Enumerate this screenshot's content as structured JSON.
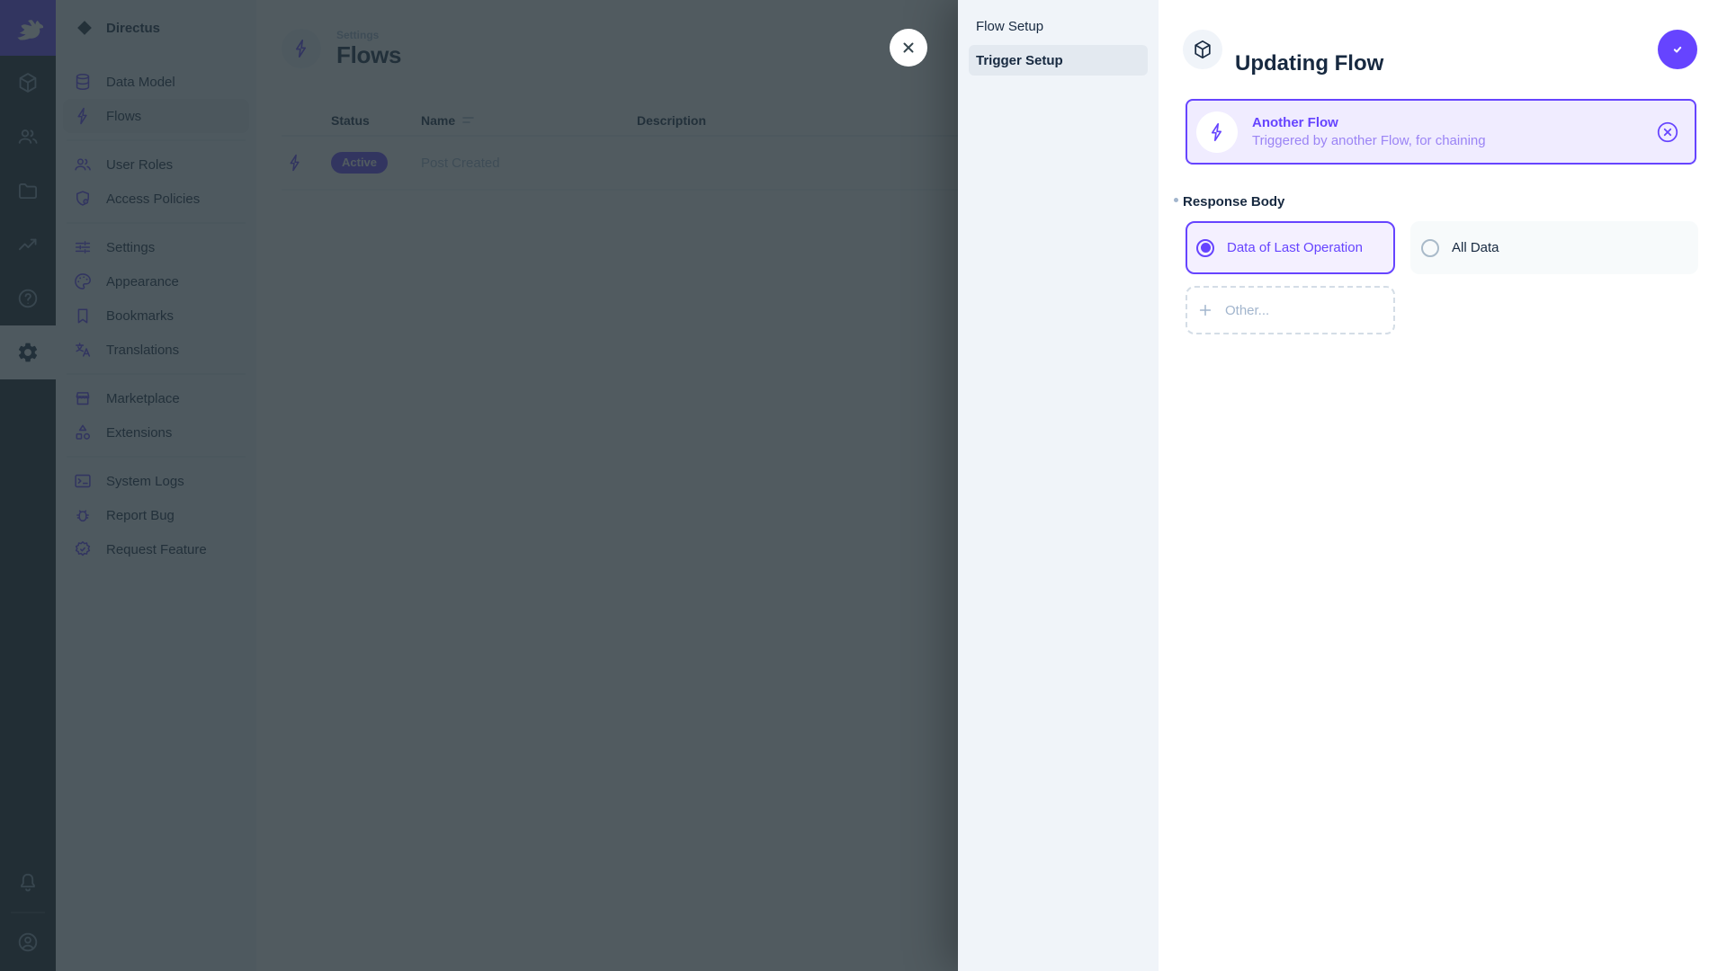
{
  "colors": {
    "accent": "#6644FF",
    "module_bar_bg": "#18212B",
    "module_icon": "#8196AB",
    "panel_bg": "#F0F4F9",
    "panel_active_bg": "#E4EAF1",
    "text_dark": "#172940",
    "text_muted": "#A2B5CD",
    "border_subtle": "#E8EEF4",
    "trigger_card_bg": "#F0ECFF",
    "trigger_sub": "#9B84F5",
    "overlay": "rgba(38,50,56,0.8)"
  },
  "module_bar": {
    "modules": [
      {
        "icon": "cube-icon"
      },
      {
        "icon": "people-icon"
      },
      {
        "icon": "folder-icon"
      },
      {
        "icon": "trending-up-icon"
      },
      {
        "icon": "help-icon"
      },
      {
        "icon": "gear-icon",
        "active": true
      }
    ]
  },
  "sidebar": {
    "project_name": "Directus",
    "items": [
      {
        "label": "Data Model",
        "icon": "database-icon"
      },
      {
        "label": "Flows",
        "icon": "bolt-icon",
        "active": true
      },
      {
        "label": "User Roles",
        "icon": "people-icon"
      },
      {
        "label": "Access Policies",
        "icon": "shield-icon"
      },
      {
        "label": "Settings",
        "icon": "sliders-icon"
      },
      {
        "label": "Appearance",
        "icon": "palette-icon"
      },
      {
        "label": "Bookmarks",
        "icon": "bookmark-icon"
      },
      {
        "label": "Translations",
        "icon": "translate-icon"
      },
      {
        "label": "Marketplace",
        "icon": "storefront-icon"
      },
      {
        "label": "Extensions",
        "icon": "shapes-icon"
      },
      {
        "label": "System Logs",
        "icon": "terminal-icon"
      },
      {
        "label": "Report Bug",
        "icon": "bug-icon"
      },
      {
        "label": "Request Feature",
        "icon": "badge-check-icon"
      }
    ]
  },
  "main": {
    "breadcrumb": "Settings",
    "title": "Flows",
    "table": {
      "columns": [
        "Status",
        "Name",
        "Description"
      ],
      "rows": [
        {
          "status": "Active",
          "name": "Post Created",
          "description": ""
        }
      ]
    }
  },
  "drawer": {
    "nav": [
      {
        "label": "Flow Setup"
      },
      {
        "label": "Trigger Setup",
        "active": true
      }
    ],
    "title": "Updating Flow",
    "trigger_card": {
      "title": "Another Flow",
      "subtitle": "Triggered by another Flow, for chaining"
    },
    "response_body": {
      "label": "Response Body",
      "required": true,
      "options": [
        {
          "label": "Data of Last Operation",
          "selected": true
        },
        {
          "label": "All Data",
          "selected": false
        }
      ],
      "other_label": "Other..."
    }
  }
}
